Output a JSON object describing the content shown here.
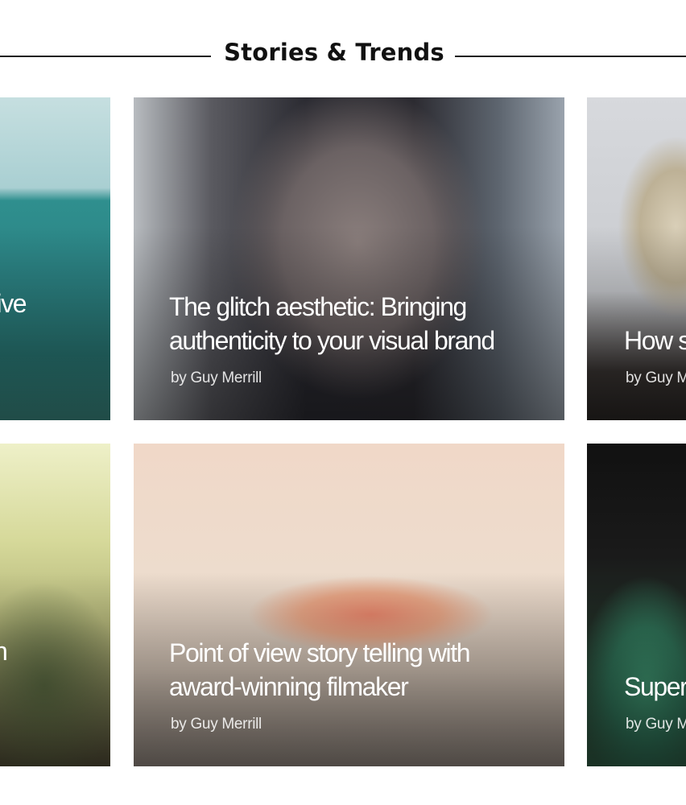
{
  "section": {
    "title": "Stories & Trends"
  },
  "cards": [
    {
      "title": "tive",
      "byline": ""
    },
    {
      "title": "The glitch aesthetic: Bringing authenticity to your visual brand",
      "byline": "by Guy Merrill"
    },
    {
      "title": "How s influen",
      "byline": "by Guy M"
    },
    {
      "title": "h",
      "byline": ""
    },
    {
      "title": "Point of view story telling with award-winning filmaker",
      "byline": "by Guy Merrill"
    },
    {
      "title": "Super visual",
      "byline": "by Guy M"
    }
  ]
}
